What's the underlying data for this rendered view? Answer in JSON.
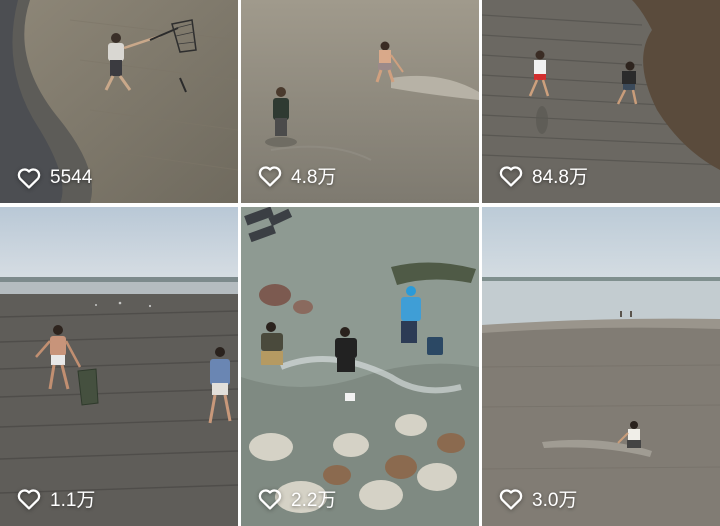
{
  "feed": {
    "tiles": [
      {
        "likes": "5544"
      },
      {
        "likes": "4.8万"
      },
      {
        "likes": "84.8万"
      },
      {
        "likes": "1.1万"
      },
      {
        "likes": "2.2万"
      },
      {
        "likes": "3.0万"
      }
    ]
  },
  "icons": {
    "like": "heart-outline-icon"
  },
  "colors": {
    "overlay_text": "#ffffff"
  }
}
